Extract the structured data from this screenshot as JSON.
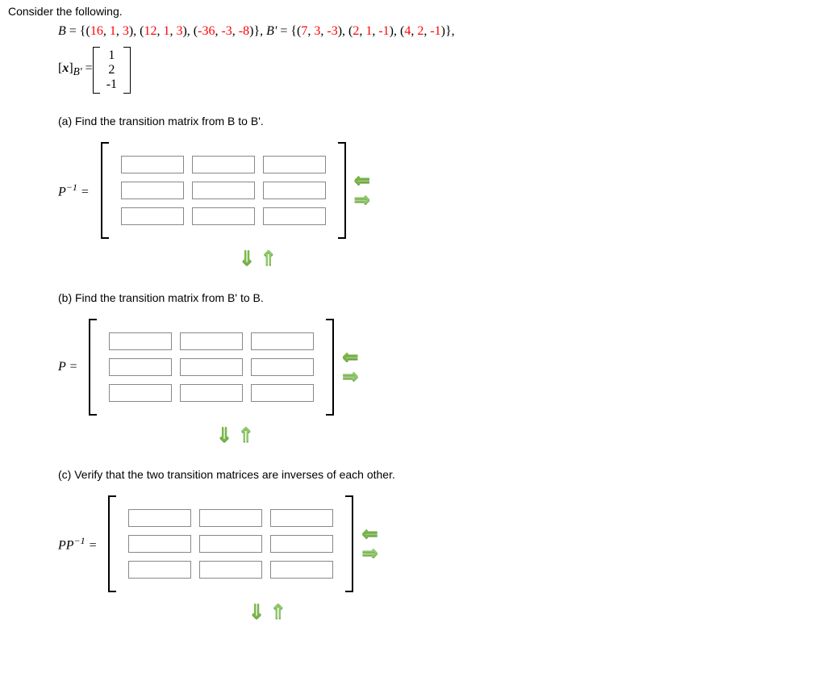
{
  "intro": "Consider the following.",
  "given": {
    "B_eq": "B = {(",
    "B_vectors": [
      [
        "16",
        "1",
        "3"
      ],
      [
        "12",
        "1",
        "3"
      ],
      [
        "-36",
        "-3",
        "-8"
      ]
    ],
    "Bp_eq": "}, B' = {(",
    "Bp_vectors": [
      [
        "7",
        "3",
        "-3"
      ],
      [
        "2",
        "1",
        "-1"
      ],
      [
        "4",
        "2",
        "-1"
      ]
    ],
    "tail": "},",
    "xlabel_pre": "[",
    "xlabel_x": "x",
    "xlabel_post": "]",
    "xlabel_sub": "B'",
    "eq": " = ",
    "xBprime": [
      "1",
      "2",
      "-1"
    ]
  },
  "parts": {
    "a": {
      "label": "(a) Find the transition matrix from B to B'.",
      "answer_label_html": "P<sup>-1</sup> ="
    },
    "b": {
      "label": "(b) Find the transition matrix from B' to B.",
      "answer_label_html": "P ="
    },
    "c": {
      "label": "(c) Verify that the two transition matrices are inverses of each other.",
      "answer_label_html": "PP<sup>-1</sup> ="
    }
  },
  "arrows": {
    "left": "⇐",
    "right": "⇒",
    "down": "⇓",
    "up": "⇑"
  },
  "matrix_dims": {
    "rows": 3,
    "cols": 3
  }
}
